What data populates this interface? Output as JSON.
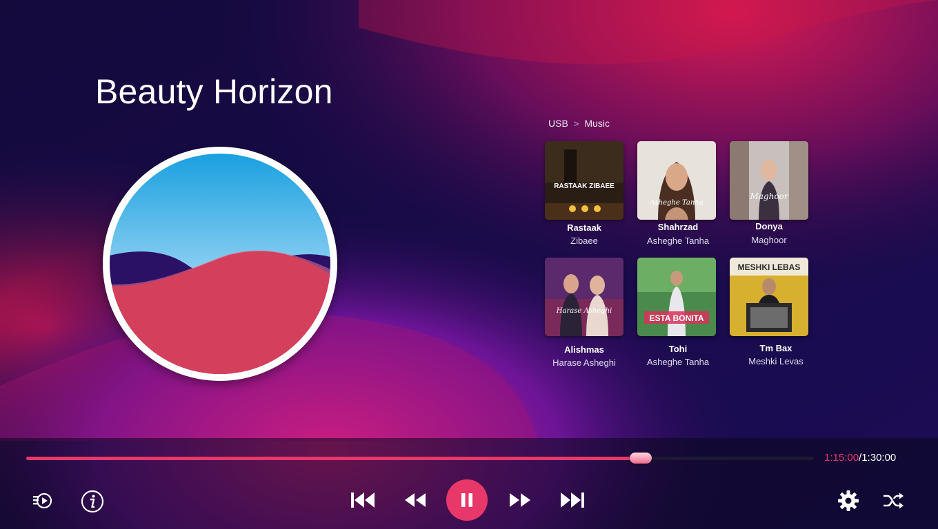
{
  "app": {
    "song_title": "Beauty Horizon"
  },
  "breadcrumb": {
    "root": "USB",
    "separator": ">",
    "current": "Music"
  },
  "library": {
    "items": [
      {
        "title": "Rastaak",
        "subtitle": "Zibaee",
        "cover_text": "RASTAAK ZIBAEE"
      },
      {
        "title": "Shahrzad",
        "subtitle": "Asheghe Tanha",
        "cover_text": "Asheghe Tanha"
      },
      {
        "title": "Donya",
        "subtitle": "Maghoor",
        "cover_text": "Maghoor"
      },
      {
        "title": "Alishmas",
        "subtitle": "Harase Asheghi",
        "cover_text": "Harase Asheghi"
      },
      {
        "title": "Tohi",
        "subtitle": "Asheghe Tanha",
        "cover_text": "ESTA BONITA"
      },
      {
        "title": "Tm Bax",
        "subtitle": "Meshki Levas",
        "cover_text": "MESHKI LEBAS"
      }
    ]
  },
  "player": {
    "current_time": "1:15:00",
    "separator": "/",
    "total_time": "1:30:00",
    "progress": 0.78
  },
  "icons": {
    "playlist": "playlist-icon",
    "info": "info-icon",
    "previous_track": "skip-previous-icon",
    "rewind": "rewind-icon",
    "pause": "pause-icon",
    "fast_forward": "fast-forward-icon",
    "next_track": "skip-next-icon",
    "settings": "gear-icon",
    "shuffle": "shuffle-icon"
  },
  "colors": {
    "accent": "#e8386a",
    "background": "#1a0a4a"
  }
}
